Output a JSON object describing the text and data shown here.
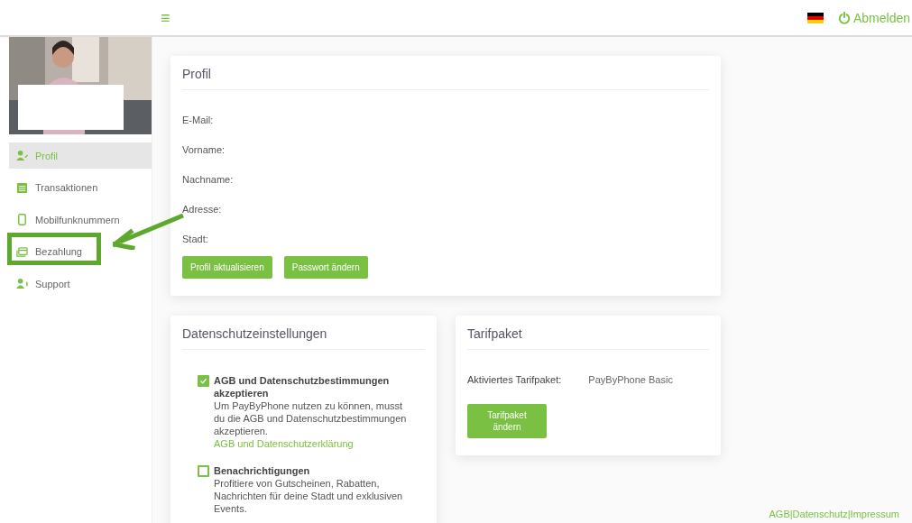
{
  "topbar": {
    "menu_icon": "≡",
    "logout": "Abmelden"
  },
  "sidebar": {
    "items": [
      {
        "label": "Profil",
        "selected": true,
        "highlighted": false
      },
      {
        "label": "Transaktionen",
        "selected": false,
        "highlighted": false
      },
      {
        "label": "Mobilfunknummern",
        "selected": false,
        "highlighted": false
      },
      {
        "label": "Bezahlung",
        "selected": false,
        "highlighted": true
      },
      {
        "label": "Support",
        "selected": false,
        "highlighted": false
      }
    ]
  },
  "profile": {
    "title": "Profil",
    "fields": [
      "E-Mail:",
      "Vorname:",
      "Nachname:",
      "Adresse:",
      "Stadt:"
    ],
    "buttons": [
      "Profil aktualisieren",
      "Passwort ändern"
    ]
  },
  "privacy": {
    "title": "Datenschutzeinstellungen",
    "options": [
      {
        "title": "AGB und Datenschutzbestimmungen akzeptieren",
        "text": "Um PayByPhone nutzen zu können, musst du die AGB und Datenschutzbestimmungen akzeptieren.",
        "link": "AGB und Datenschutzerklärung",
        "checked": true
      },
      {
        "title": "Benachrichtigungen",
        "text": "Profitiere von Gutscheinen, Rabatten, Nachrichten für deine Stadt und exklusiven Events.",
        "checked": false
      }
    ]
  },
  "tariff": {
    "title": "Tarifpaket",
    "label": "Aktiviertes Tarifpaket:",
    "value": "PayByPhone Basic",
    "button": "Tarifpaket ändern"
  },
  "footer": {
    "links": [
      "AGB",
      "Datenschutz",
      "Impressum"
    ],
    "separator": "|"
  }
}
